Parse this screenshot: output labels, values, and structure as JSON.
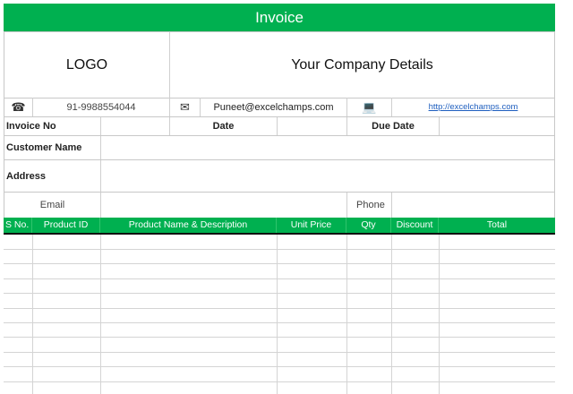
{
  "title": "Invoice",
  "logo": "LOGO",
  "company_details": "Your Company Details",
  "contact": {
    "phone_icon": "phone-icon",
    "phone": "91-9988554044",
    "email_icon": "envelope-icon",
    "email": "Puneet@excelchamps.com",
    "web_icon": "laptop-icon",
    "website": "http://excelchamps.com"
  },
  "fields": {
    "invoice_no": "Invoice No",
    "date": "Date",
    "due_date": "Due Date",
    "customer_name": "Customer Name",
    "address": "Address",
    "email": "Email",
    "phone": "Phone"
  },
  "table": {
    "columns": [
      "S No.",
      "Product ID",
      "Product Name & Description",
      "Unit Price",
      "Qty",
      "Discount",
      "Total"
    ],
    "rows": []
  },
  "colors": {
    "accent": "#00b050",
    "grid": "#d4d4d4"
  }
}
